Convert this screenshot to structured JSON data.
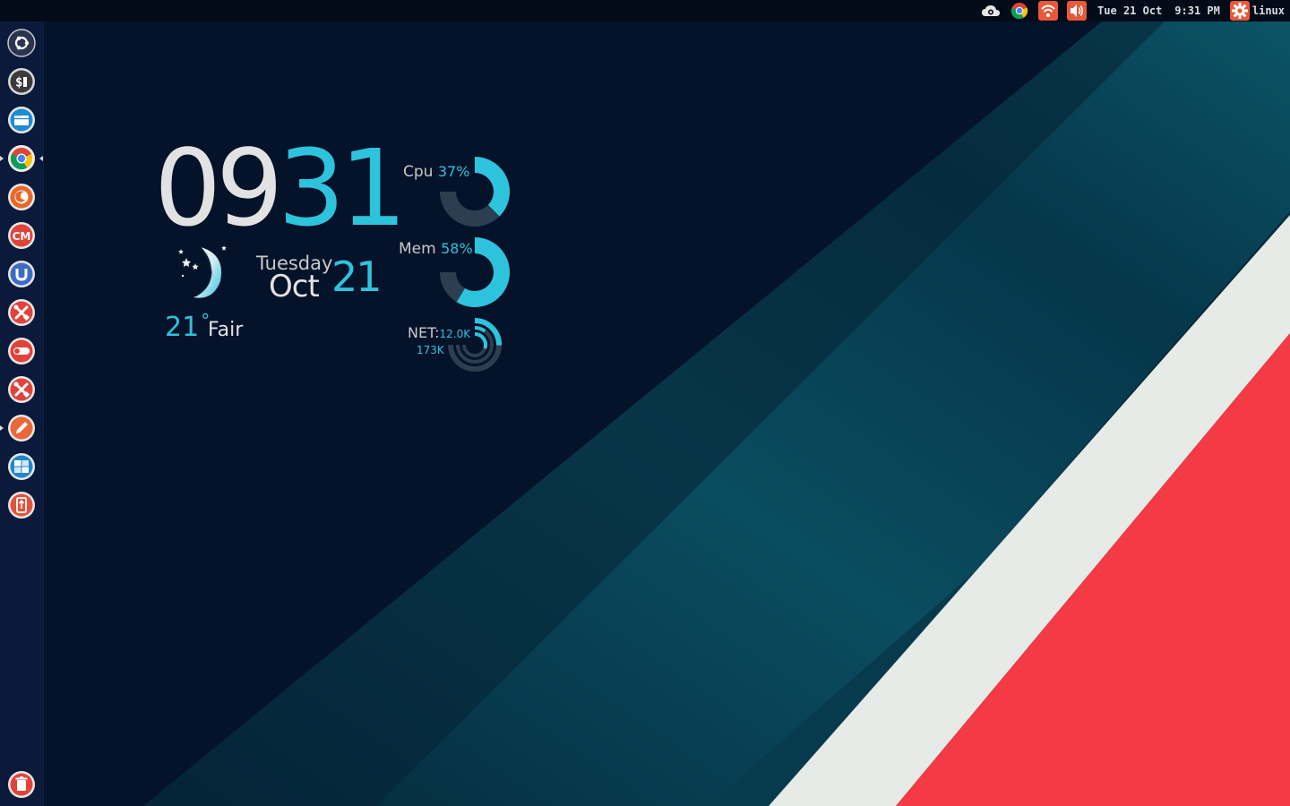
{
  "top_panel": {
    "date": "Tue 21 Oct",
    "time": "9:31 PM",
    "username": "linux",
    "icons": [
      "cloud-icon",
      "chrome-icon",
      "wifi-icon",
      "volume-icon",
      "system-gear-icon"
    ]
  },
  "launcher": {
    "items": [
      {
        "name": "ubuntu-dash-icon",
        "bg": "#dcdcdc"
      },
      {
        "name": "terminal-icon",
        "bg": "#d8d8d8"
      },
      {
        "name": "files-icon",
        "bg": "#2d9fd8"
      },
      {
        "name": "chrome-icon",
        "bg": "#e9e9e9"
      },
      {
        "name": "firefox-icon",
        "bg": "#e86a2a"
      },
      {
        "name": "ccsm-icon",
        "bg": "#e0433a"
      },
      {
        "name": "ubuntu-tweak-icon",
        "bg": "#3d6bc4"
      },
      {
        "name": "system-tools-icon",
        "bg": "#e0433a"
      },
      {
        "name": "toggle-settings-icon",
        "bg": "#e0433a"
      },
      {
        "name": "tools-icon",
        "bg": "#e0433a"
      },
      {
        "name": "text-editor-icon",
        "bg": "#e8683a"
      },
      {
        "name": "workspace-switcher-icon",
        "bg": "#1f86c9"
      },
      {
        "name": "usb-creator-icon",
        "bg": "#e0533a"
      }
    ],
    "trash": {
      "name": "trash-icon",
      "bg": "#e0433a"
    }
  },
  "clock": {
    "hours": "09",
    "minutes": "31"
  },
  "date_widget": {
    "weekday": "Tuesday",
    "month": "Oct",
    "day": "21"
  },
  "weather": {
    "temperature": "21",
    "degree": "°",
    "condition": "Fair"
  },
  "meters": {
    "cpu": {
      "label": "Cpu",
      "value": "37%",
      "fraction": 0.37
    },
    "mem": {
      "label": "Mem",
      "value": "58%",
      "fraction": 0.58
    },
    "net": {
      "label": "NET:",
      "up": "12.0K",
      "down": "173K"
    }
  },
  "colors": {
    "accent": "#2ec3dc",
    "text": "#e2e2e2",
    "track": "#2d3e50",
    "wall_dark": "#04122a",
    "wall_teal": "#0a4a5c",
    "wall_white": "#e6ebe8",
    "wall_red": "#f43a44"
  }
}
